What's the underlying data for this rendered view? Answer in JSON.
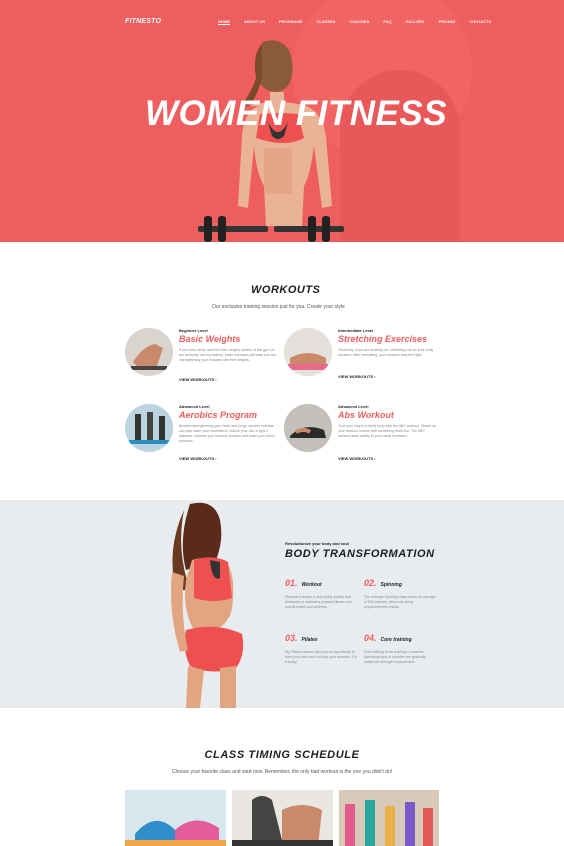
{
  "brand": {
    "logo": "FITNESTO",
    "accent": "#ee5e5e"
  },
  "nav": [
    "HOME",
    "ABOUT US",
    "PROGRAMS",
    "CLASSES",
    "COACHES",
    "FAQ",
    "GALLERY",
    "PRICING",
    "CONTACTS"
  ],
  "hero": {
    "title": "WOMEN FITNESS"
  },
  "workouts": {
    "title": "WORKOUTS",
    "subtitle": "Our exclusive training session just for you. Create your style",
    "items": [
      {
        "level": "Beginner Level",
        "title": "Basic Weights",
        "desc": "If you have never used the free weights section of the gym (or are seriously out of practice), basic exercises will ease you into strengthening your muscles with free weights.",
        "link": "VIEW WORKOUTS"
      },
      {
        "level": "Intermediate Level",
        "title": "Stretching Exercises",
        "desc": "Obviously, if you are working out, stretching can do your body wonders. After exercising, your muscles may feel tight.",
        "link": "VIEW WORKOUTS"
      },
      {
        "level": "Advanced Level",
        "title": "Aerobics Program",
        "desc": "Besides strengthening your heart and lungs, aerobic exercise can help lower your cholesterol, reduce your risk of type 2 diabetes, improve your immune function and lower your blood pressure.",
        "link": "VIEW WORKOUTS"
      },
      {
        "level": "Advanced Level",
        "title": "Abs Workout",
        "desc": "Tone your way to a bikini body with the ABC workout. Shake up your workout routine with something that's fun. The ABC workout adds variety to your usual exercises.",
        "link": "VIEW WORKOUTS"
      }
    ]
  },
  "transformation": {
    "pretitle": "Revolutionize your body and soul",
    "title": "BODY TRANSFORMATION",
    "features": [
      {
        "num": "01.",
        "name": "Workout",
        "text": "Physical exercise is any bodily activity that enhances or maintains physical fitness and overall health and wellness."
      },
      {
        "num": "02.",
        "name": "Spinning",
        "text": "The average Spinning class burns an average of 500 calories, which can bring unprecedented results."
      },
      {
        "num": "03.",
        "name": "Pilates",
        "text": "My Pilates classes give you an opportunity to train your mind and not only your muscles. Try it today!"
      },
      {
        "num": "04.",
        "name": "Core training",
        "text": "Core training is the training of muscles. Special groups of muscles are gradually loaded for strength improvement."
      }
    ]
  },
  "schedule": {
    "title": "CLASS TIMING SCHEDULE",
    "subtitle": "Choose your favorite class and start now. Remember, the only bad workout is the one you didn't do!"
  }
}
